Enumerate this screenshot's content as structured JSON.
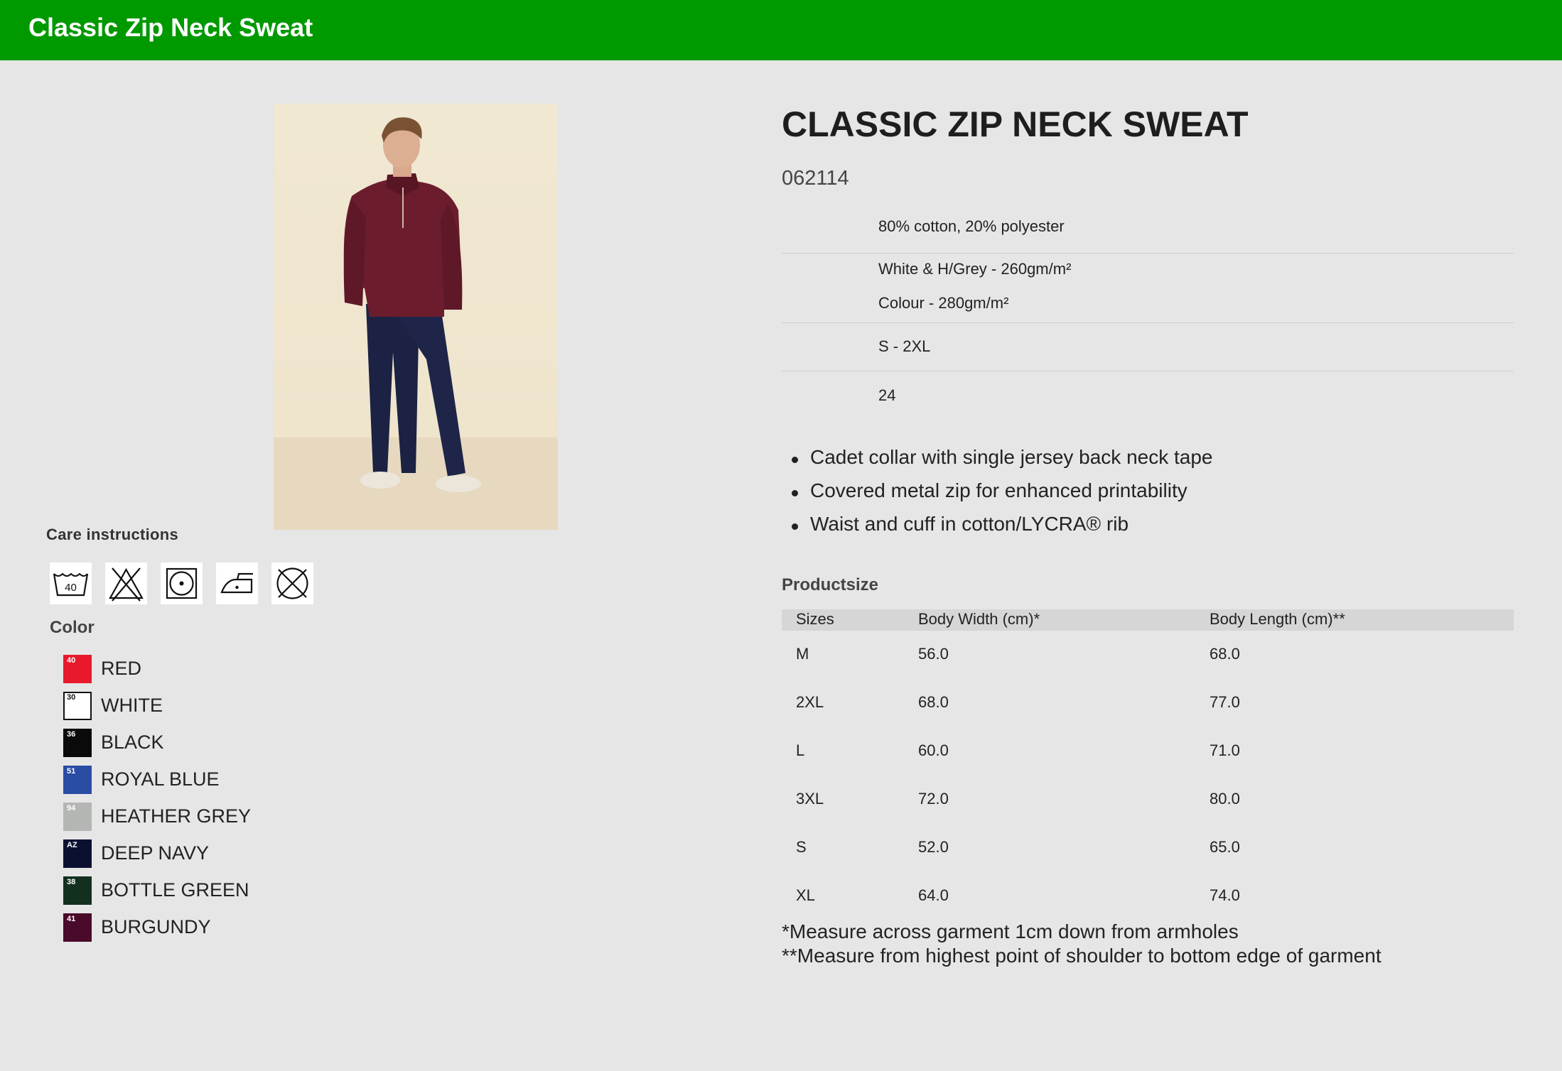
{
  "header": {
    "title": "Classic Zip Neck Sweat"
  },
  "product": {
    "title": "CLASSIC ZIP NECK SWEAT",
    "code": "062114",
    "specs": {
      "composition": "80% cotton, 20% polyester",
      "weight_line1": "White & H/Grey - 260gm/m²",
      "weight_line2": "Colour - 280gm/m²",
      "sizes": "S - 2XL",
      "pack": "24"
    },
    "features": [
      "Cadet collar with single jersey back neck tape",
      "Covered metal zip for enhanced printability",
      "Waist and cuff in cotton/LYCRA® rib"
    ]
  },
  "care": {
    "title": "Care instructions",
    "icons": [
      {
        "name": "wash-40-icon",
        "label": "40"
      },
      {
        "name": "do-not-bleach-icon"
      },
      {
        "name": "tumble-dry-icon"
      },
      {
        "name": "iron-icon"
      },
      {
        "name": "do-not-dry-clean-icon"
      }
    ]
  },
  "colors": {
    "title": "Color",
    "items": [
      {
        "code": "40",
        "name": "RED",
        "hex": "#e8192c"
      },
      {
        "code": "30",
        "name": "WHITE",
        "hex": "#ffffff"
      },
      {
        "code": "36",
        "name": "BLACK",
        "hex": "#0a0a0a"
      },
      {
        "code": "51",
        "name": "ROYAL BLUE",
        "hex": "#2a4ca3"
      },
      {
        "code": "94",
        "name": "HEATHER GREY",
        "hex": "#b4b6b4"
      },
      {
        "code": "AZ",
        "name": "DEEP NAVY",
        "hex": "#0c1030"
      },
      {
        "code": "38",
        "name": "BOTTLE GREEN",
        "hex": "#13301f"
      },
      {
        "code": "41",
        "name": "BURGUNDY",
        "hex": "#4a0a2a"
      }
    ]
  },
  "productsize": {
    "title": "Productsize",
    "headers": [
      "Sizes",
      "Body Width (cm)*",
      "Body Length (cm)**"
    ],
    "rows": [
      [
        "M",
        "56.0",
        "68.0"
      ],
      [
        "2XL",
        "68.0",
        "77.0"
      ],
      [
        "L",
        "60.0",
        "71.0"
      ],
      [
        "3XL",
        "72.0",
        "80.0"
      ],
      [
        "S",
        "52.0",
        "65.0"
      ],
      [
        "XL",
        "64.0",
        "74.0"
      ]
    ],
    "notes": [
      "*Measure across garment 1cm down from armholes",
      "**Measure from highest point of shoulder to bottom edge of garment"
    ]
  }
}
